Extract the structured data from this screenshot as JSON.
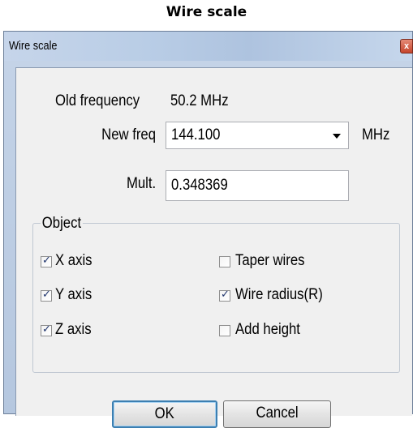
{
  "caption": "Wire scale",
  "window": {
    "title": "Wire scale",
    "close_glyph": "x"
  },
  "form": {
    "old_freq_label": "Old frequency",
    "old_freq_value": "50.2 MHz",
    "new_freq_label": "New freq",
    "new_freq_value": "144.100",
    "new_freq_unit": "MHz",
    "mult_label": "Mult.",
    "mult_value": "0.348369"
  },
  "object_group": {
    "title": "Object",
    "left": [
      {
        "label": "X axis",
        "checked": true
      },
      {
        "label": "Y axis",
        "checked": true
      },
      {
        "label": "Z axis",
        "checked": true
      }
    ],
    "right": [
      {
        "label": "Taper wires",
        "checked": false
      },
      {
        "label": "Wire radius(R)",
        "checked": true
      },
      {
        "label": "Add height",
        "checked": false
      }
    ]
  },
  "buttons": {
    "ok": "OK",
    "cancel": "Cancel"
  }
}
